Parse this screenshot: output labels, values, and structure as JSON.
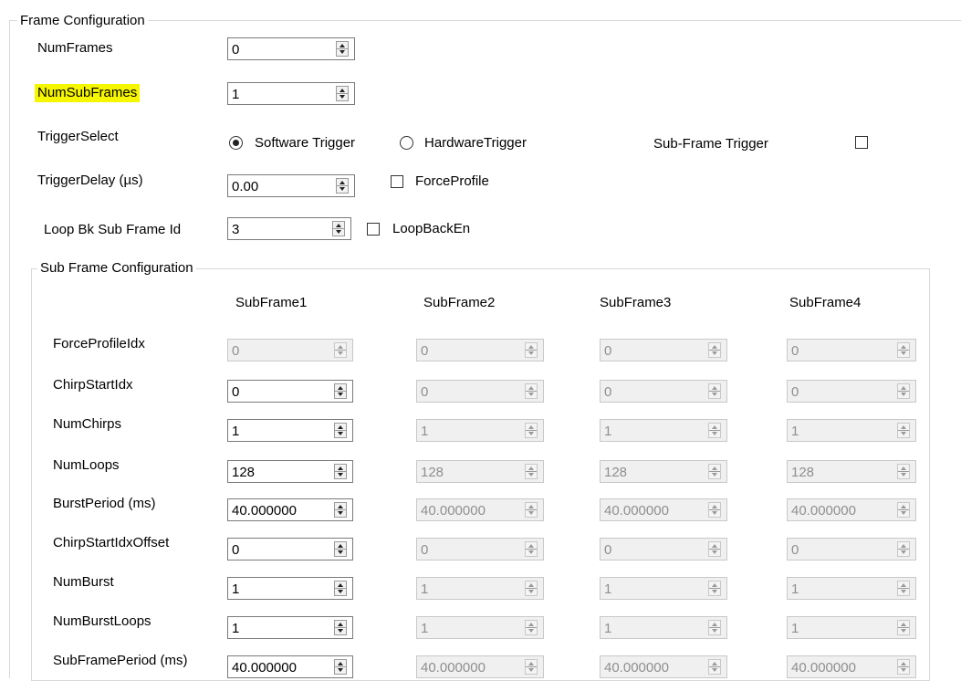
{
  "frame_config": {
    "title": "Frame Configuration",
    "num_frames": {
      "label": "NumFrames",
      "value": "0"
    },
    "num_subframes": {
      "label": "NumSubFrames",
      "value": "1"
    },
    "trigger_select": {
      "label": "TriggerSelect",
      "options": [
        "Software Trigger",
        "HardwareTrigger"
      ],
      "selected": "Software Trigger"
    },
    "sub_frame_trigger": {
      "label": "Sub-Frame Trigger",
      "checked": false
    },
    "trigger_delay": {
      "label": "TriggerDelay (µs)",
      "value": "0.00"
    },
    "force_profile": {
      "label": "ForceProfile",
      "checked": false
    },
    "loop_bk_sub_frame_id": {
      "label": "Loop Bk Sub Frame Id",
      "value": "3"
    },
    "loop_back_en": {
      "label": "LoopBackEn",
      "checked": false
    }
  },
  "sub_frame_config": {
    "title": "Sub Frame Configuration",
    "columns": [
      "SubFrame1",
      "SubFrame2",
      "SubFrame3",
      "SubFrame4"
    ],
    "rows": [
      {
        "label": "ForceProfileIdx",
        "values": [
          "0",
          "0",
          "0",
          "0"
        ],
        "enabled": [
          false,
          false,
          false,
          false
        ]
      },
      {
        "label": "ChirpStartIdx",
        "values": [
          "0",
          "0",
          "0",
          "0"
        ],
        "enabled": [
          true,
          false,
          false,
          false
        ]
      },
      {
        "label": "NumChirps",
        "values": [
          "1",
          "1",
          "1",
          "1"
        ],
        "enabled": [
          true,
          false,
          false,
          false
        ]
      },
      {
        "label": "NumLoops",
        "values": [
          "128",
          "128",
          "128",
          "128"
        ],
        "enabled": [
          true,
          false,
          false,
          false
        ]
      },
      {
        "label": "BurstPeriod (ms)",
        "values": [
          "40.000000",
          "40.000000",
          "40.000000",
          "40.000000"
        ],
        "enabled": [
          true,
          false,
          false,
          false
        ]
      },
      {
        "label": "ChirpStartIdxOffset",
        "values": [
          "0",
          "0",
          "0",
          "0"
        ],
        "enabled": [
          true,
          false,
          false,
          false
        ]
      },
      {
        "label": "NumBurst",
        "values": [
          "1",
          "1",
          "1",
          "1"
        ],
        "enabled": [
          true,
          false,
          false,
          false
        ]
      },
      {
        "label": "NumBurstLoops",
        "values": [
          "1",
          "1",
          "1",
          "1"
        ],
        "enabled": [
          true,
          false,
          false,
          false
        ]
      },
      {
        "label": "SubFramePeriod (ms)",
        "values": [
          "40.000000",
          "40.000000",
          "40.000000",
          "40.000000"
        ],
        "enabled": [
          true,
          false,
          false,
          false
        ]
      }
    ]
  },
  "colors": {
    "highlight": "#f6f600",
    "disabled_text": "#8f8f8f",
    "border": "#7a7a7a"
  }
}
